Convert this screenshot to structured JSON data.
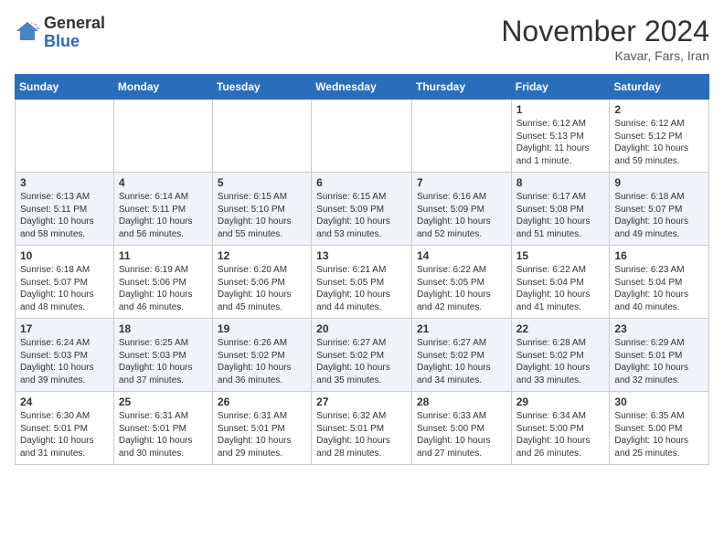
{
  "header": {
    "logo_line1": "General",
    "logo_line2": "Blue",
    "month": "November 2024",
    "location": "Kavar, Fars, Iran"
  },
  "weekdays": [
    "Sunday",
    "Monday",
    "Tuesday",
    "Wednesday",
    "Thursday",
    "Friday",
    "Saturday"
  ],
  "weeks": [
    [
      {
        "day": "",
        "text": ""
      },
      {
        "day": "",
        "text": ""
      },
      {
        "day": "",
        "text": ""
      },
      {
        "day": "",
        "text": ""
      },
      {
        "day": "",
        "text": ""
      },
      {
        "day": "1",
        "text": "Sunrise: 6:12 AM\nSunset: 5:13 PM\nDaylight: 11 hours and 1 minute."
      },
      {
        "day": "2",
        "text": "Sunrise: 6:12 AM\nSunset: 5:12 PM\nDaylight: 10 hours and 59 minutes."
      }
    ],
    [
      {
        "day": "3",
        "text": "Sunrise: 6:13 AM\nSunset: 5:11 PM\nDaylight: 10 hours and 58 minutes."
      },
      {
        "day": "4",
        "text": "Sunrise: 6:14 AM\nSunset: 5:11 PM\nDaylight: 10 hours and 56 minutes."
      },
      {
        "day": "5",
        "text": "Sunrise: 6:15 AM\nSunset: 5:10 PM\nDaylight: 10 hours and 55 minutes."
      },
      {
        "day": "6",
        "text": "Sunrise: 6:15 AM\nSunset: 5:09 PM\nDaylight: 10 hours and 53 minutes."
      },
      {
        "day": "7",
        "text": "Sunrise: 6:16 AM\nSunset: 5:09 PM\nDaylight: 10 hours and 52 minutes."
      },
      {
        "day": "8",
        "text": "Sunrise: 6:17 AM\nSunset: 5:08 PM\nDaylight: 10 hours and 51 minutes."
      },
      {
        "day": "9",
        "text": "Sunrise: 6:18 AM\nSunset: 5:07 PM\nDaylight: 10 hours and 49 minutes."
      }
    ],
    [
      {
        "day": "10",
        "text": "Sunrise: 6:18 AM\nSunset: 5:07 PM\nDaylight: 10 hours and 48 minutes."
      },
      {
        "day": "11",
        "text": "Sunrise: 6:19 AM\nSunset: 5:06 PM\nDaylight: 10 hours and 46 minutes."
      },
      {
        "day": "12",
        "text": "Sunrise: 6:20 AM\nSunset: 5:06 PM\nDaylight: 10 hours and 45 minutes."
      },
      {
        "day": "13",
        "text": "Sunrise: 6:21 AM\nSunset: 5:05 PM\nDaylight: 10 hours and 44 minutes."
      },
      {
        "day": "14",
        "text": "Sunrise: 6:22 AM\nSunset: 5:05 PM\nDaylight: 10 hours and 42 minutes."
      },
      {
        "day": "15",
        "text": "Sunrise: 6:22 AM\nSunset: 5:04 PM\nDaylight: 10 hours and 41 minutes."
      },
      {
        "day": "16",
        "text": "Sunrise: 6:23 AM\nSunset: 5:04 PM\nDaylight: 10 hours and 40 minutes."
      }
    ],
    [
      {
        "day": "17",
        "text": "Sunrise: 6:24 AM\nSunset: 5:03 PM\nDaylight: 10 hours and 39 minutes."
      },
      {
        "day": "18",
        "text": "Sunrise: 6:25 AM\nSunset: 5:03 PM\nDaylight: 10 hours and 37 minutes."
      },
      {
        "day": "19",
        "text": "Sunrise: 6:26 AM\nSunset: 5:02 PM\nDaylight: 10 hours and 36 minutes."
      },
      {
        "day": "20",
        "text": "Sunrise: 6:27 AM\nSunset: 5:02 PM\nDaylight: 10 hours and 35 minutes."
      },
      {
        "day": "21",
        "text": "Sunrise: 6:27 AM\nSunset: 5:02 PM\nDaylight: 10 hours and 34 minutes."
      },
      {
        "day": "22",
        "text": "Sunrise: 6:28 AM\nSunset: 5:02 PM\nDaylight: 10 hours and 33 minutes."
      },
      {
        "day": "23",
        "text": "Sunrise: 6:29 AM\nSunset: 5:01 PM\nDaylight: 10 hours and 32 minutes."
      }
    ],
    [
      {
        "day": "24",
        "text": "Sunrise: 6:30 AM\nSunset: 5:01 PM\nDaylight: 10 hours and 31 minutes."
      },
      {
        "day": "25",
        "text": "Sunrise: 6:31 AM\nSunset: 5:01 PM\nDaylight: 10 hours and 30 minutes."
      },
      {
        "day": "26",
        "text": "Sunrise: 6:31 AM\nSunset: 5:01 PM\nDaylight: 10 hours and 29 minutes."
      },
      {
        "day": "27",
        "text": "Sunrise: 6:32 AM\nSunset: 5:01 PM\nDaylight: 10 hours and 28 minutes."
      },
      {
        "day": "28",
        "text": "Sunrise: 6:33 AM\nSunset: 5:00 PM\nDaylight: 10 hours and 27 minutes."
      },
      {
        "day": "29",
        "text": "Sunrise: 6:34 AM\nSunset: 5:00 PM\nDaylight: 10 hours and 26 minutes."
      },
      {
        "day": "30",
        "text": "Sunrise: 6:35 AM\nSunset: 5:00 PM\nDaylight: 10 hours and 25 minutes."
      }
    ]
  ]
}
